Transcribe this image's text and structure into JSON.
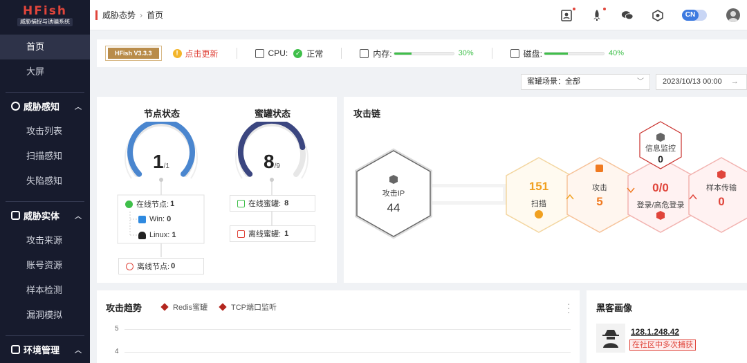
{
  "logo": {
    "title": "HFish",
    "subtitle": "威胁捕捉与诱骗系统"
  },
  "sidebar": {
    "top_items": [
      {
        "label": "首页",
        "active": true
      },
      {
        "label": "大屏",
        "active": false
      }
    ],
    "groups": [
      {
        "label": "威胁感知",
        "icon": "radar-icon",
        "items": [
          "攻击列表",
          "扫描感知",
          "失陷感知"
        ]
      },
      {
        "label": "威胁实体",
        "icon": "shield-icon",
        "items": [
          "攻击来源",
          "账号资源",
          "样本检测",
          "漏洞模拟"
        ]
      },
      {
        "label": "环境管理",
        "icon": "gear-icon",
        "items": []
      }
    ]
  },
  "header": {
    "breadcrumb": [
      "威胁态势",
      "首页"
    ],
    "icons": [
      "report-icon",
      "rocket-icon",
      "wechat-icon",
      "hexagon-icon"
    ],
    "lang": "CN"
  },
  "status": {
    "version": "HFish V3.3.3",
    "update_label": "点击更新",
    "cpu_label": "CPU:",
    "cpu_status": "正常",
    "mem_label": "内存:",
    "mem_pct": 30,
    "mem_pct_text": "30%",
    "disk_label": "磁盘:",
    "disk_pct": 40,
    "disk_pct_text": "40%"
  },
  "filters": {
    "scene": "蜜罐场景：全部",
    "date": "2023/10/13 00:00"
  },
  "nodes": {
    "title": "节点状态",
    "online": 1,
    "total": 1,
    "online_label": "在线节点:",
    "online_value": "1",
    "win_label": "Win:",
    "win_value": "0",
    "linux_label": "Linux:",
    "linux_value": "1",
    "offline_label": "离线节点:",
    "offline_value": "0"
  },
  "honeypots": {
    "title": "蜜罐状态",
    "online": 8,
    "total": 9,
    "online_label": "在线蜜罐:",
    "online_value": "8",
    "offline_label": "离线蜜罐:",
    "offline_value": "1"
  },
  "attack_chain": {
    "title": "攻击链",
    "stages": [
      {
        "label": "攻击IP",
        "value": "44",
        "color": "#555555"
      },
      {
        "label": "扫描",
        "value": "151",
        "color": "#f0a020"
      },
      {
        "label": "攻击",
        "value": "5",
        "color": "#f07a20"
      },
      {
        "label": "登录/高危登录",
        "value": "0/0",
        "color": "#e0453b"
      },
      {
        "label": "信息监控",
        "value": "0",
        "color": "#c9302c"
      },
      {
        "label": "样本传输",
        "value": "0",
        "color": "#e0453b"
      }
    ]
  },
  "trend": {
    "title": "攻击趋势",
    "legend": [
      "Redis蜜罐",
      "TCP端口监听"
    ],
    "legend_color": "#b3261e",
    "yticks": [
      "5",
      "4"
    ]
  },
  "hacker": {
    "title": "黑客画像",
    "ip": "128.1.248.42",
    "tag": "在社区中多次捕获"
  }
}
